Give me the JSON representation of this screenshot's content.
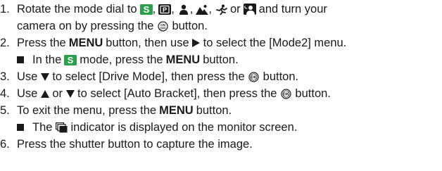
{
  "colors": {
    "accent_green": "#2aa04a",
    "text": "#1a1a1a"
  },
  "step1": {
    "number": "1.",
    "text_a": "Rotate the mode dial to",
    "comma_a": ",",
    "comma_b": ",",
    "comma_c": ",",
    "comma_d": ",",
    "or_text": "or",
    "text_b": "and turn your",
    "text_c": "camera on by pressing the",
    "text_d": "button."
  },
  "step2": {
    "number": "2.",
    "text_a": "Press the",
    "menu": "MENU",
    "text_b": "button, then use",
    "text_c": "to select the [Mode2] menu.",
    "note_a": "In the",
    "note_b": "mode, press the",
    "note_menu": "MENU",
    "note_c": "button."
  },
  "step3": {
    "number": "3.",
    "text_a": "Use",
    "text_b": "to select [Drive Mode], then press the",
    "text_c": "button."
  },
  "step4": {
    "number": "4.",
    "text_a": "Use",
    "or_text": "or",
    "text_b": "to select [Auto Bracket], then press the",
    "text_c": "button."
  },
  "step5": {
    "number": "5.",
    "text_a": "To exit the menu, press the",
    "menu": "MENU",
    "text_b": "button.",
    "note_a": "The",
    "note_b": "indicator is displayed on the monitor screen."
  },
  "step6": {
    "number": "6.",
    "text": "Press the shutter button to capture the image."
  },
  "icons": [
    "scene-s-mode-icon",
    "program-p-mode-icon",
    "portrait-mode-icon",
    "landscape-mode-icon",
    "sports-mode-icon",
    "night-portrait-mode-icon",
    "power-button-icon",
    "right-arrow-icon",
    "down-arrow-icon",
    "up-arrow-icon",
    "ok-button-icon",
    "square-bullet-icon",
    "continuous-drive-indicator-icon"
  ]
}
